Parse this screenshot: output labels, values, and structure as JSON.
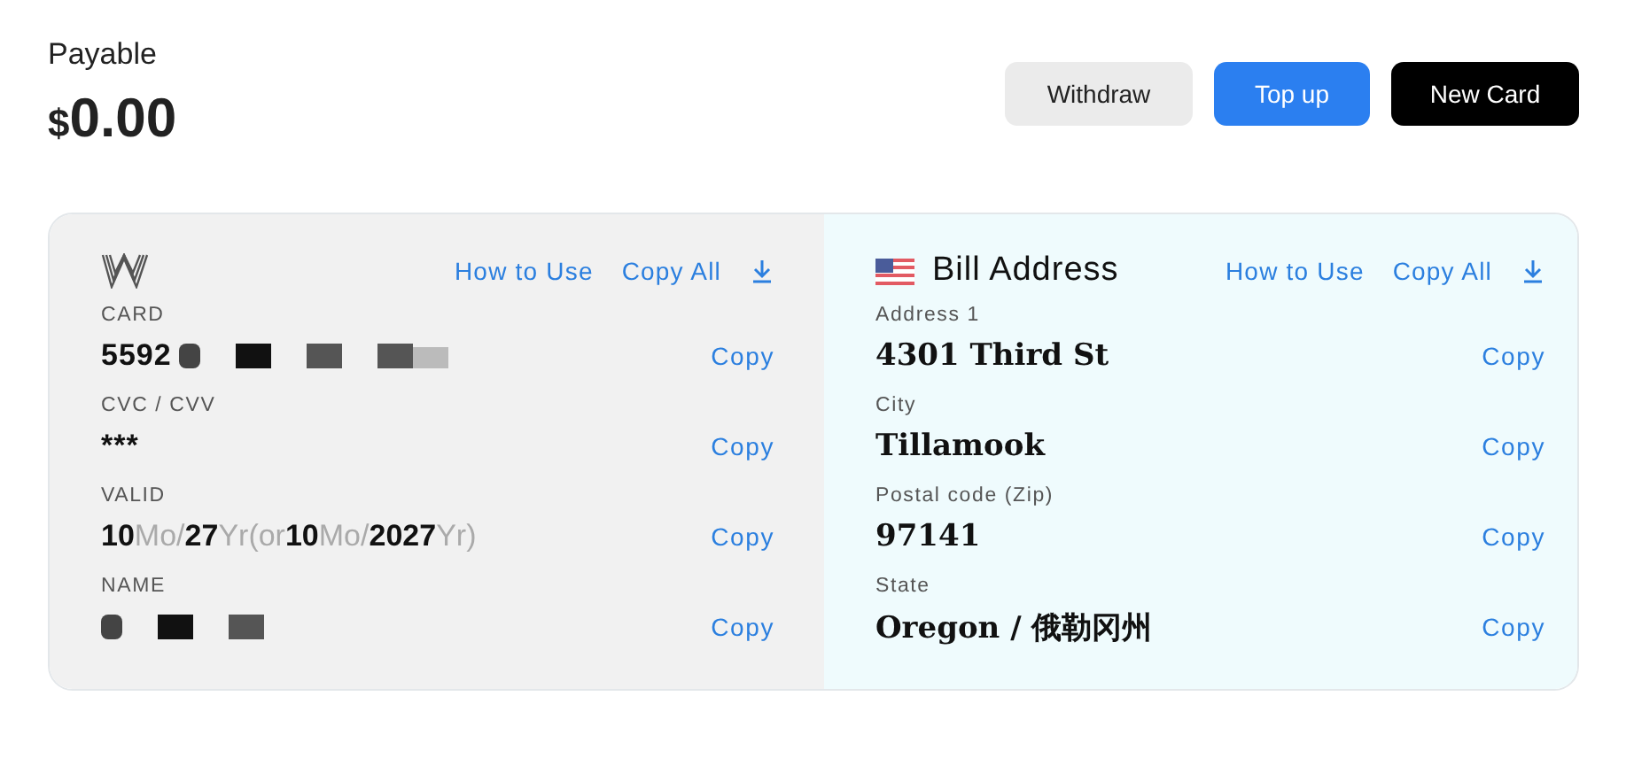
{
  "summary": {
    "title": "Payable",
    "currency": "$",
    "amount": "0.00"
  },
  "buttons": [
    {
      "label": "Withdraw",
      "kind": "secondary"
    },
    {
      "label": "Top up",
      "kind": "primary"
    },
    {
      "label": "New Card",
      "kind": "dark"
    }
  ],
  "card_panel": {
    "links": [
      "How to Use",
      "Copy All"
    ],
    "fields": [
      {
        "label": "CARD",
        "value": "5592",
        "redacted": true,
        "copy": "Copy"
      },
      {
        "label": "CVC / CVV",
        "value": "***",
        "redacted": false,
        "copy": "Copy"
      },
      {
        "label": "VALID",
        "value": "**10**Mo/**27**Yr(or**10**Mo/**2027**Yr)",
        "kind": "date",
        "redacted": false,
        "copy": "Copy"
      },
      {
        "label": "NAME",
        "redacted": true,
        "copy": "Copy"
      }
    ]
  },
  "address_panel": {
    "title": "Bill Address",
    "links": [
      "How to Use",
      "Copy All"
    ],
    "fields": [
      {
        "label": "Address 1",
        "value": "4301 Third St",
        "copy": "Copy"
      },
      {
        "label": "City",
        "value": "Tillamook",
        "copy": "Copy"
      },
      {
        "label": "Postal code (Zip)",
        "value": "97141",
        "copy": "Copy"
      },
      {
        "label": "State",
        "value": "Oregon / 俄勒冈州",
        "copy": "Copy"
      }
    ]
  }
}
